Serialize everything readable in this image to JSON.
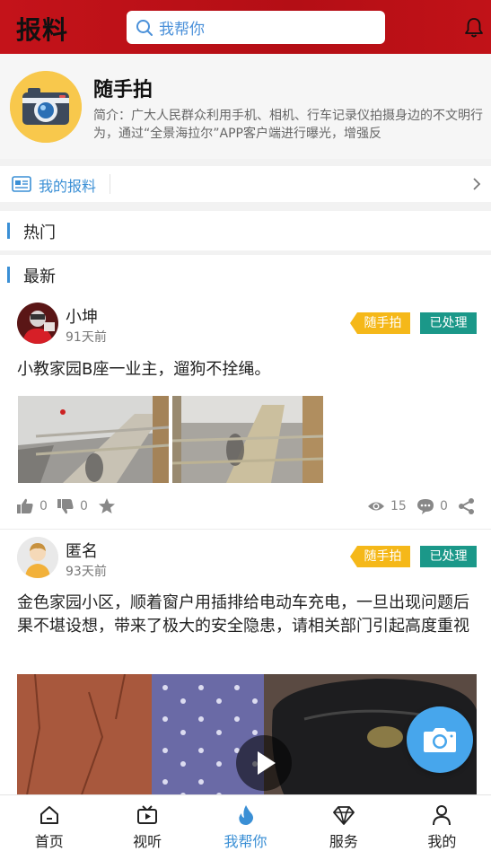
{
  "header": {
    "title": "报料",
    "search_placeholder": "我帮你",
    "bell_icon": "bell-icon",
    "accent": "#c4131a"
  },
  "topic": {
    "name": "随手拍",
    "description": "简介：广大人民群众利用手机、相机、行车记录仪拍摄身边的不文明行为，通过“全景海拉尔”APP客户端进行曝光，增强反",
    "logo_icon": "camera-icon"
  },
  "my_report": {
    "label": "我的报料",
    "icon": "newspaper-icon"
  },
  "sections": {
    "hot": "热门",
    "latest": "最新"
  },
  "posts": [
    {
      "name": "小坤",
      "time": "91天前",
      "topic_tag": "随手拍",
      "status_tag": "已处理",
      "text": "小教家园B座一业主，遛狗不拴绳。",
      "likes": "0",
      "dislikes": "0",
      "views": "15",
      "comments": "0"
    },
    {
      "name": "匿名",
      "time": "93天前",
      "topic_tag": "随手拍",
      "status_tag": "已处理",
      "text": "金色家园小区，顺着窗户用插排给电动车充电，一旦出现问题后果不堪设想，带来了极大的安全隐患，请相关部门引起高度重视"
    }
  ],
  "colors": {
    "brand_blue": "#3a8fd5",
    "tag_yellow": "#f5b819",
    "tag_green": "#1b9889"
  },
  "bottom_nav": [
    {
      "label": "首页",
      "icon": "home-icon"
    },
    {
      "label": "视听",
      "icon": "video-icon"
    },
    {
      "label": "我帮你",
      "icon": "flame-icon",
      "active": true
    },
    {
      "label": "服务",
      "icon": "diamond-icon"
    },
    {
      "label": "我的",
      "icon": "user-icon"
    }
  ]
}
